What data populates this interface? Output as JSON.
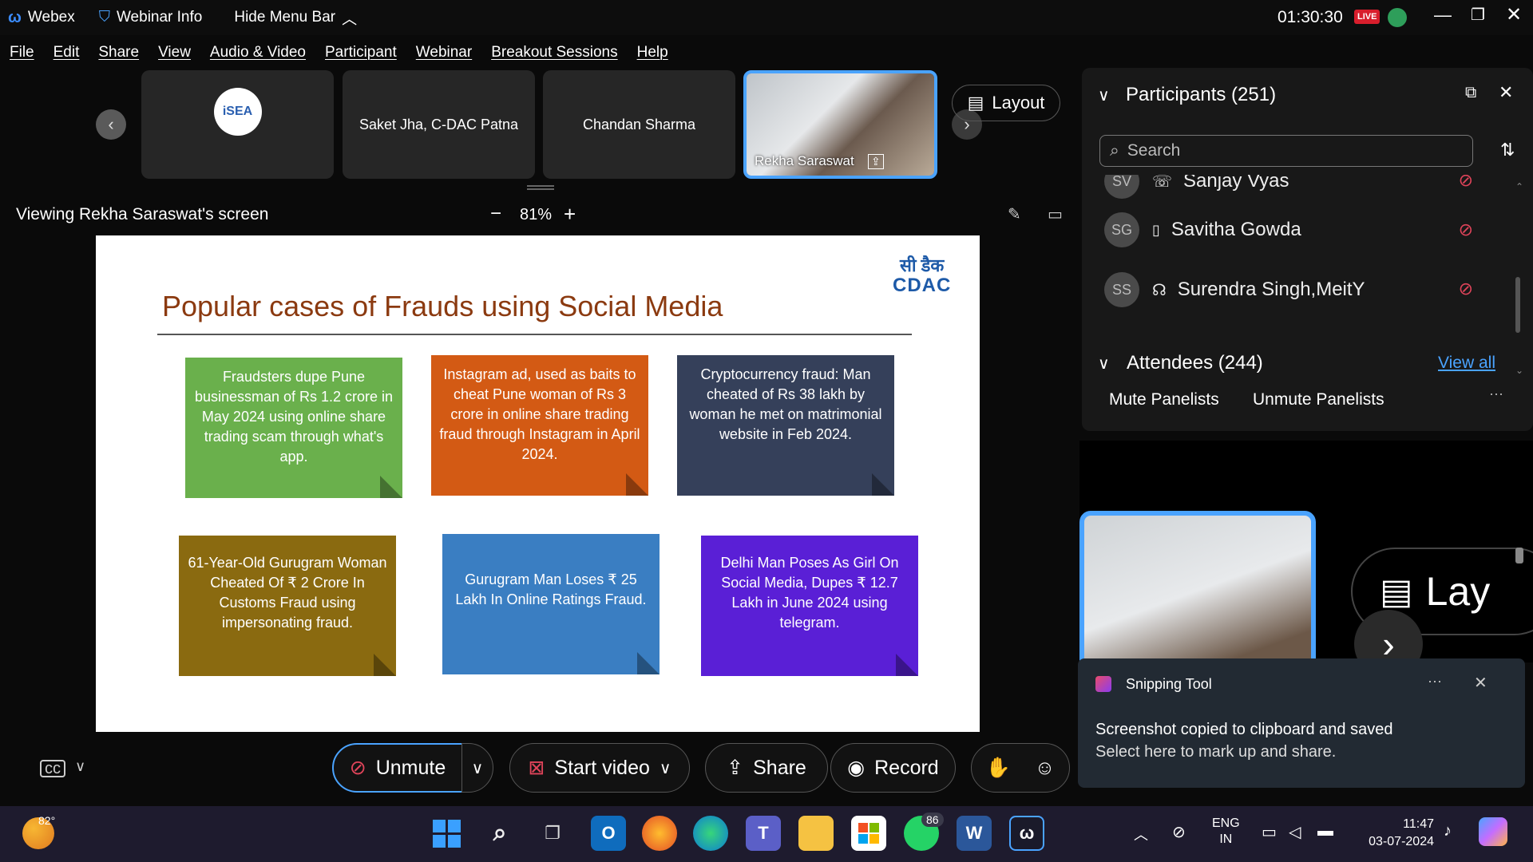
{
  "titlebar": {
    "app_name": "Webex",
    "webinar_info": "Webinar Info",
    "hide_menu": "Hide Menu Bar",
    "timer": "01:30:30",
    "live": "LIVE"
  },
  "menu": [
    "File",
    "Edit",
    "Share",
    "View",
    "Audio & Video",
    "Participant",
    "Webinar",
    "Breakout Sessions",
    "Help"
  ],
  "tiles": {
    "logo_text": "iSEA",
    "t2": "Saket Jha, C-DAC Patna",
    "t3": "Chandan Sharma",
    "t4": "Rekha Saraswat",
    "layout": "Layout"
  },
  "viewing": "Viewing Rekha Saraswat's screen",
  "zoom": {
    "minus": "−",
    "level": "81%",
    "plus": "+"
  },
  "slide": {
    "title": "Popular cases of Frauds using Social Media",
    "logo_hindi": "सी डैक",
    "logo_text": "CDAC",
    "cards": [
      {
        "text": "Fraudsters dupe Pune businessman of Rs 1.2 crore in May 2024 using online share trading scam through what's app.",
        "color": "#6ab04c"
      },
      {
        "text": "Instagram ad,  used as baits to cheat Pune woman of Rs 3 crore in online share trading fraud through Instagram in April 2024.",
        "color": "#d35a14"
      },
      {
        "text": "Cryptocurrency fraud: Man cheated of Rs 38 lakh by woman he met on matrimonial website in Feb 2024.",
        "color": "#35405a"
      },
      {
        "text": "61-Year-Old Gurugram Woman Cheated Of ₹ 2 Crore In Customs Fraud using impersonating fraud.",
        "color": "#8a6a10"
      },
      {
        "text": "Gurugram Man Loses ₹ 25 Lakh In Online Ratings Fraud.",
        "color": "#3a7ec2"
      },
      {
        "text": "Delhi Man Poses As Girl On Social Media, Dupes ₹ 12.7 Lakh in June 2024 using telegram.",
        "color": "#5a1fd6"
      }
    ]
  },
  "participants": {
    "header": "Participants (251)",
    "search_placeholder": "Search",
    "rows": [
      {
        "initials": "SV",
        "name": "Sanjay Vyas"
      },
      {
        "initials": "SG",
        "name": "Savitha Gowda"
      },
      {
        "initials": "SS",
        "name": "Surendra Singh,MeitY"
      }
    ],
    "attendees": "Attendees (244)",
    "view_all": "View all",
    "mute": "Mute Panelists",
    "unmute": "Unmute Panelists",
    "more": "···"
  },
  "preview": {
    "layout_partial": "Lay"
  },
  "toast": {
    "app": "Snipping Tool",
    "line1": "Screenshot copied to clipboard and saved",
    "line2": "Select here to mark up and share."
  },
  "toolbar": {
    "unmute": "Unmute",
    "video": "Start video",
    "share": "Share",
    "record": "Record"
  },
  "taskbar": {
    "weather": "82°",
    "badge": "86",
    "lang1": "ENG",
    "lang2": "IN",
    "time": "11:47",
    "date": "03-07-2024"
  }
}
